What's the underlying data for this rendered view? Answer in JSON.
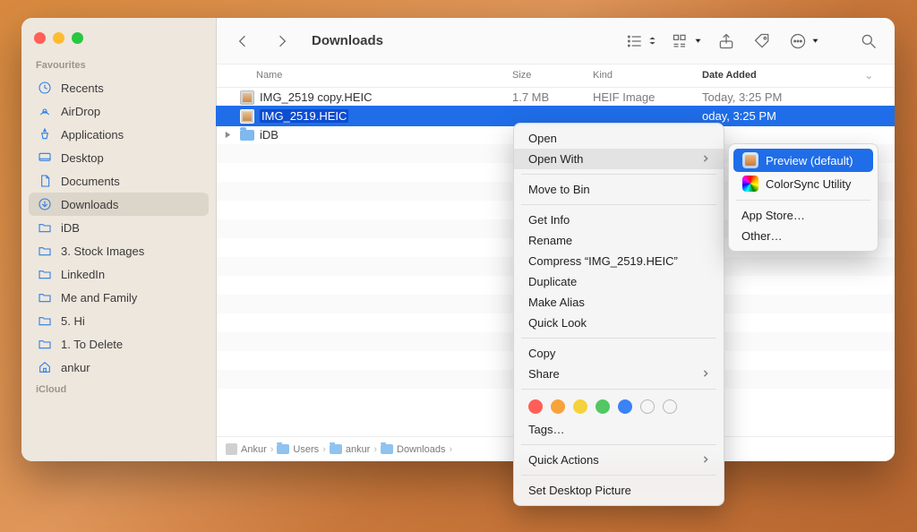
{
  "window": {
    "title": "Downloads"
  },
  "sidebar": {
    "sections": [
      {
        "label": "Favourites",
        "items": [
          {
            "label": "Recents",
            "icon": "clock"
          },
          {
            "label": "AirDrop",
            "icon": "airdrop"
          },
          {
            "label": "Applications",
            "icon": "apps"
          },
          {
            "label": "Desktop",
            "icon": "desktop"
          },
          {
            "label": "Documents",
            "icon": "doc"
          },
          {
            "label": "Downloads",
            "icon": "download",
            "active": true
          },
          {
            "label": "iDB",
            "icon": "folder"
          },
          {
            "label": "3. Stock Images",
            "icon": "folder"
          },
          {
            "label": "LinkedIn",
            "icon": "folder"
          },
          {
            "label": "Me and Family",
            "icon": "folder"
          },
          {
            "label": "5. Hi",
            "icon": "folder"
          },
          {
            "label": "1. To Delete",
            "icon": "folder"
          },
          {
            "label": "ankur",
            "icon": "home"
          }
        ]
      },
      {
        "label": "iCloud",
        "items": []
      }
    ]
  },
  "columns": {
    "name": "Name",
    "size": "Size",
    "kind": "Kind",
    "date": "Date Added"
  },
  "files": [
    {
      "name": "IMG_2519 copy.HEIC",
      "size": "1.7 MB",
      "kind": "HEIF Image",
      "date": "Today, 3:25 PM",
      "type": "img"
    },
    {
      "name": "IMG_2519.HEIC",
      "size": "",
      "kind": "",
      "date": "oday, 3:25 PM",
      "type": "img",
      "selected": true
    },
    {
      "name": "iDB",
      "size": "",
      "kind": "",
      "date": "",
      "type": "folder",
      "expandable": true
    }
  ],
  "pathbar": [
    "Ankur",
    "Users",
    "ankur",
    "Downloads"
  ],
  "context_menu": {
    "groups": [
      [
        {
          "label": "Open"
        },
        {
          "label": "Open With",
          "submenu": true,
          "highlight": true
        }
      ],
      [
        {
          "label": "Move to Bin"
        }
      ],
      [
        {
          "label": "Get Info"
        },
        {
          "label": "Rename"
        },
        {
          "label": "Compress “IMG_2519.HEIC”"
        },
        {
          "label": "Duplicate"
        },
        {
          "label": "Make Alias"
        },
        {
          "label": "Quick Look"
        }
      ],
      [
        {
          "label": "Copy"
        },
        {
          "label": "Share",
          "submenu": true
        }
      ],
      "tags",
      [
        {
          "label": "Tags…"
        }
      ],
      [
        {
          "label": "Quick Actions",
          "submenu": true
        }
      ],
      [
        {
          "label": "Set Desktop Picture"
        }
      ]
    ],
    "tag_colors": [
      "#ff5f57",
      "#f7a33c",
      "#f5d23b",
      "#53c764",
      "#3b82f6"
    ]
  },
  "submenu": {
    "items": [
      {
        "label": "Preview (default)",
        "icon": "preview",
        "selected": true
      },
      {
        "label": "ColorSync Utility",
        "icon": "colorsync"
      }
    ],
    "footer": [
      "App Store…",
      "Other…"
    ]
  }
}
